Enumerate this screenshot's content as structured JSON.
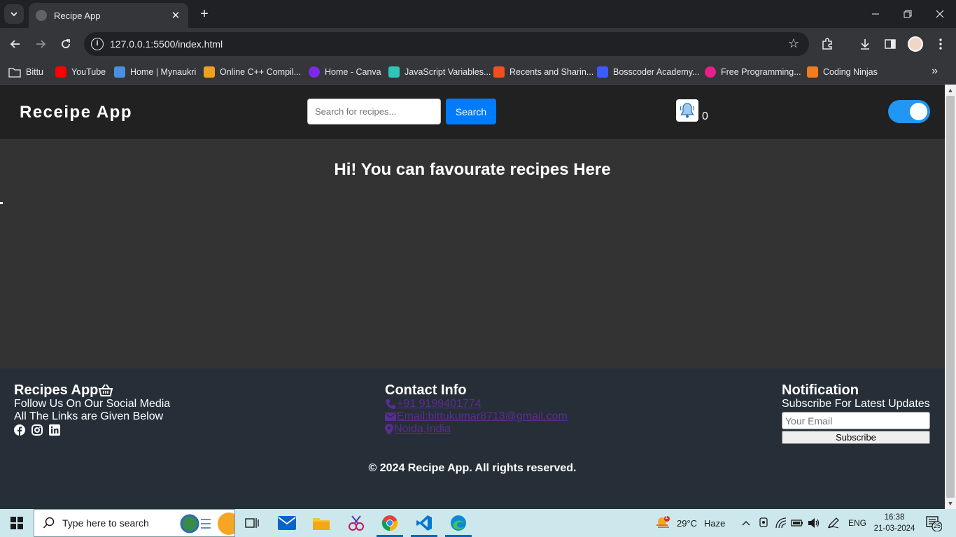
{
  "browser": {
    "tab_title": "Recipe App",
    "url": "127.0.0.1:5500/index.html",
    "bookmarks": [
      {
        "label": "Bittu",
        "color": "#e8eaed"
      },
      {
        "label": "YouTube",
        "color": "#ff0000"
      },
      {
        "label": "Home | Mynaukri",
        "color": "#4a90e2"
      },
      {
        "label": "Online C++ Compil...",
        "color": "#f0a020"
      },
      {
        "label": "Home - Canva",
        "color": "#7d2ae8"
      },
      {
        "label": "JavaScript Variables...",
        "color": "#2ec4b6"
      },
      {
        "label": "Recents and Sharin...",
        "color": "#f24e1e"
      },
      {
        "label": "Bosscoder Academy...",
        "color": "#3a5bff"
      },
      {
        "label": "Free Programming...",
        "color": "#e91e8c"
      },
      {
        "label": "Coding Ninjas",
        "color": "#f47c20"
      }
    ]
  },
  "app": {
    "brand": "Receipe App",
    "search": {
      "placeholder": "Search for recipes...",
      "button": "Search"
    },
    "notification_count": "0",
    "toggle_on": true,
    "main_heading": "Hi! You can favourate recipes Here"
  },
  "footer": {
    "col1": {
      "title": "Recipes App",
      "line1": "Follow Us On Our Social Media",
      "line2": "All The Links are Given Below",
      "icons": [
        "facebook-icon",
        "instagram-icon",
        "linkedin-icon"
      ]
    },
    "col2": {
      "title": "Contact Info",
      "phone": "+91 9199401774",
      "email": "Email:bittukumar8713@gmail.com",
      "location": "Noida,India"
    },
    "col3": {
      "title": "Notification",
      "subtitle": "Subscribe For Latest Updates",
      "email_placeholder": "Your Email",
      "button": "Subscribe"
    },
    "copyright": "© 2024 Recipe App. All rights reserved."
  },
  "taskbar": {
    "search_placeholder": "Type here to search",
    "weather": {
      "temp": "29°C",
      "condition": "Haze",
      "badge": "1"
    },
    "language": "ENG",
    "time": "16:38",
    "date": "21-03-2024",
    "notification_count": "25"
  },
  "colors": {
    "accent": "#007bff",
    "toggle": "#2196f3",
    "footer_bg": "#262f37",
    "link": "#5b2d8f"
  }
}
